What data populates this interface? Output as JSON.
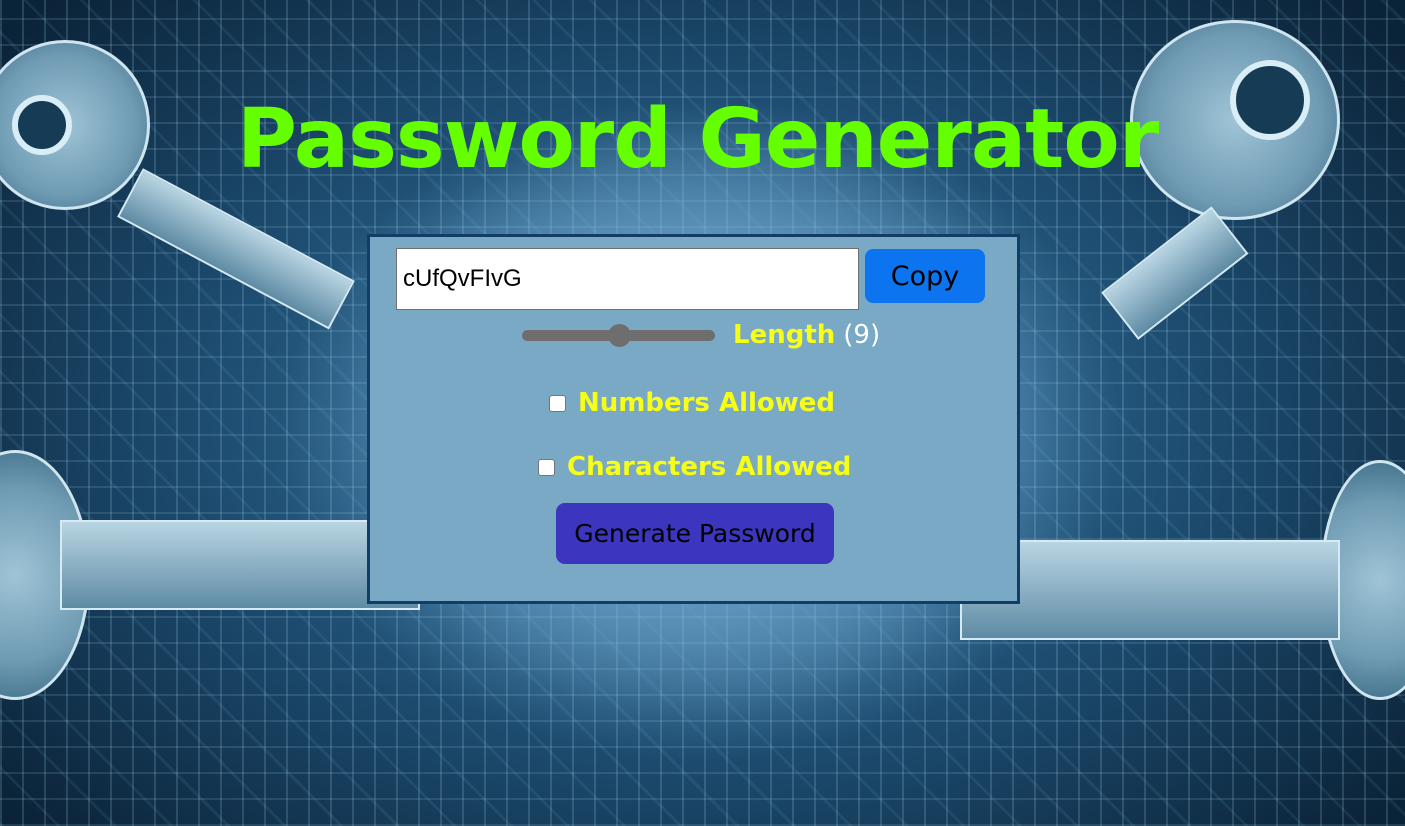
{
  "title": "Password Generator",
  "password_field": {
    "value": "cUfQvFIvG"
  },
  "copy_button": {
    "label": "Copy"
  },
  "length": {
    "label": "Length",
    "display": "(9)",
    "slider_fraction": 0.5
  },
  "options": [
    {
      "label": "Numbers Allowed",
      "checked": false
    },
    {
      "label": "Characters Allowed",
      "checked": false
    }
  ],
  "generate_button": {
    "label": "Generate Password"
  },
  "colors": {
    "title": "#66ff00",
    "label": "#f7ff17",
    "copy_button": "#0d74f0",
    "generate_button": "#3b36bd",
    "panel": "#7aa9c6",
    "panel_border": "#123d66"
  }
}
